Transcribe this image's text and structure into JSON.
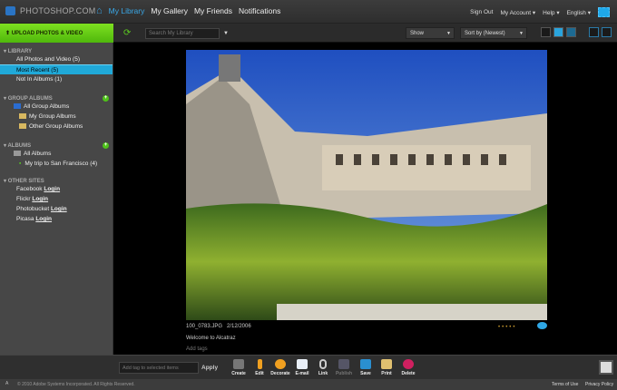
{
  "header": {
    "brand": "PHOTOSHOP.COM",
    "nav": [
      "My Library",
      "My Gallery",
      "My Friends",
      "Notifications"
    ],
    "links": [
      "Sign Out",
      "My Account",
      "Help",
      "English"
    ]
  },
  "subbar": {
    "upload": "UPLOAD PHOTOS & VIDEO",
    "search_placeholder": "Search My Library",
    "show": "Show",
    "sort": "Sort by (Newest)"
  },
  "sidebar": {
    "library": {
      "title": "LIBRARY",
      "items": [
        "All Photos and Video (5)",
        "Most Recent (5)",
        "Not In Albums (1)"
      ]
    },
    "group_albums": {
      "title": "GROUP ALBUMS",
      "items": [
        "All Group Albums",
        "My Group Albums",
        "Other Group Albums"
      ]
    },
    "albums": {
      "title": "ALBUMS",
      "items": [
        "All Albums",
        "My trip to San Francisco (4)"
      ]
    },
    "other_sites": {
      "title": "OTHER SITES",
      "login": "Login",
      "items": [
        "Facebook",
        "Flickr",
        "Photobucket",
        "Picasa"
      ]
    }
  },
  "photo": {
    "filename": "100_0783.JPG",
    "date": "2/12/2006",
    "caption": "Welcome to Alcatraz",
    "add_tags": "Add tags",
    "rating": 0
  },
  "toolbar": {
    "tag_placeholder": "Add tag to selected items",
    "apply": "Apply",
    "tools": [
      "Create",
      "Edit",
      "Decorate",
      "E-mail",
      "Link",
      "Publish",
      "Save",
      "Print",
      "Delete"
    ]
  },
  "footer": {
    "copyright": "© 2010 Adobe Systems Incorporated. All Rights Reserved.",
    "terms": "Terms of Use",
    "privacy": "Privacy Policy"
  }
}
